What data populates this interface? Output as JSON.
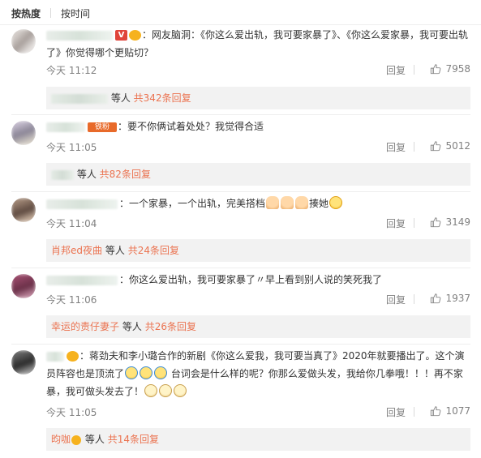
{
  "tabs": {
    "hot": "按热度",
    "time": "按时间"
  },
  "comments": [
    {
      "text": "网友脑洞：《你这么爱出轨，我可要家暴了》、《你这么爱家暴，我可要出轨了》你觉得哪个更贴切？",
      "time": "今天 11:12",
      "reply_label": "回复",
      "likes": "7958",
      "replies_suffix": "等人",
      "replies_count": "共342条回复"
    },
    {
      "text": "要不你俩试着处处？我觉得合适",
      "fan_badge": "铁粉",
      "time": "今天 11:05",
      "reply_label": "回复",
      "likes": "5012",
      "replies_suffix": "等人",
      "replies_count": "共82条回复"
    },
    {
      "text_a": "一个家暴，一个出轨，完美搭档",
      "text_b": "揍她",
      "time": "今天 11:04",
      "reply_label": "回复",
      "likes": "3149",
      "replies_name": "肖邦ed夜曲",
      "replies_suffix": "等人",
      "replies_count": "共24条回复"
    },
    {
      "text": "你这么爱出轨，我可要家暴了〃早上看到别人说的笑死我了",
      "time": "今天 11:06",
      "reply_label": "回复",
      "likes": "1937",
      "replies_name": "幸运的责仔妻子",
      "replies_suffix": "等人",
      "replies_count": "共26条回复"
    },
    {
      "text_a": "蒋劲夫和李小璐合作的新剧《你这么爱我，我可要当真了》2020年就要播出了。这个演员阵容也是顶流了",
      "text_b": "台词会是什么样的呢？你那么爱做头发，我给你几拳哦！！！再不家暴，我可做头发去了！",
      "time": "今天 11:05",
      "reply_label": "回复",
      "likes": "1077",
      "replies_name": "昀咖",
      "replies_suffix": "等人",
      "replies_count": "共14条回复"
    }
  ],
  "colors": {
    "link": "#eb7350",
    "meta": "#808080",
    "reply_bg": "#f2f2f2"
  },
  "icons": {
    "like": "thumbs-up-icon",
    "vip": "verified-v-icon",
    "crown": "crown-badge-icon"
  }
}
